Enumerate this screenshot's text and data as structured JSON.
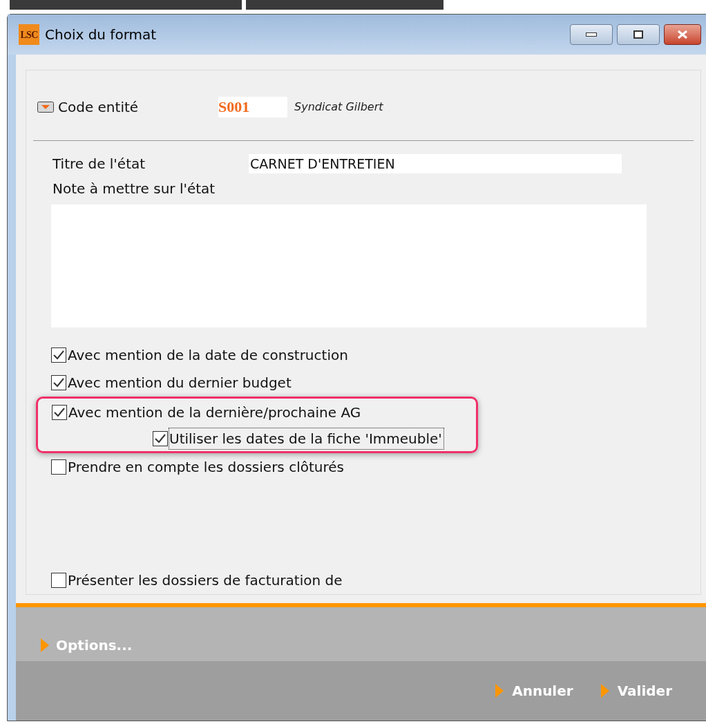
{
  "window": {
    "title": "Choix du format",
    "logo": "LSC"
  },
  "entity": {
    "label": "Code entité",
    "code": "S001",
    "name": "Syndicat Gilbert"
  },
  "report_title": {
    "label": "Titre de l'état",
    "value": "CARNET D'ENTRETIEN"
  },
  "note": {
    "label": "Note à mettre sur l'état"
  },
  "options": [
    {
      "label": "Avec mention de la date de construction",
      "checked": true,
      "focused": false,
      "highlighted": false
    },
    {
      "label": "Avec mention du dernier budget",
      "checked": true,
      "focused": false,
      "highlighted": false
    },
    {
      "label": "Avec mention de la dernière/prochaine AG",
      "checked": true,
      "focused": false,
      "highlighted": true,
      "children": [
        {
          "label": "Utiliser les dates de la fiche 'Immeuble'",
          "checked": true,
          "focused": true
        }
      ]
    },
    {
      "label": "Prendre en compte les dossiers clôturés",
      "checked": false,
      "focused": false,
      "highlighted": false
    }
  ],
  "billing_option": {
    "label": "Présenter les dossiers de facturation de",
    "checked": false
  },
  "footer": {
    "options_link": "Options...",
    "buttons": [
      {
        "label": "Annuler"
      },
      {
        "label": "Valider"
      }
    ]
  }
}
